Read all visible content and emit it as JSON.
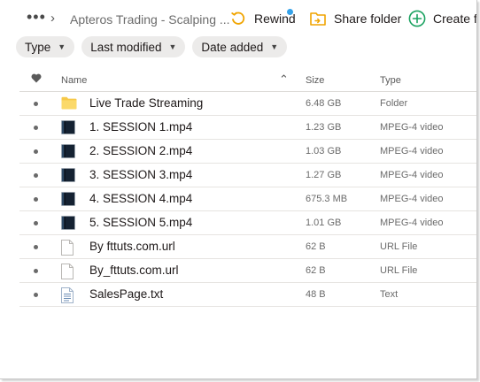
{
  "header": {
    "breadcrumb": "Apteros Trading - Scalping ...",
    "rewind_label": "Rewind",
    "share_label": "Share folder",
    "create_label": "Create fol"
  },
  "filters": [
    "Type",
    "Last modified",
    "Date added"
  ],
  "columns": {
    "name": "Name",
    "size": "Size",
    "type": "Type"
  },
  "files": [
    {
      "name": "Live Trade Streaming",
      "size": "6.48 GB",
      "type": "Folder",
      "icon": "folder-icon"
    },
    {
      "name": "1. SESSION 1.mp4",
      "size": "1.23 GB",
      "type": "MPEG-4 video",
      "icon": "video-icon"
    },
    {
      "name": "2. SESSION 2.mp4",
      "size": "1.03 GB",
      "type": "MPEG-4 video",
      "icon": "video-icon"
    },
    {
      "name": "3. SESSION 3.mp4",
      "size": "1.27 GB",
      "type": "MPEG-4 video",
      "icon": "video-icon"
    },
    {
      "name": "4. SESSION 4.mp4",
      "size": "675.3 MB",
      "type": "MPEG-4 video",
      "icon": "video-icon"
    },
    {
      "name": "5. SESSION 5.mp4",
      "size": "1.01 GB",
      "type": "MPEG-4 video",
      "icon": "video-icon"
    },
    {
      "name": "By fttuts.com.url",
      "size": "62 B",
      "type": "URL File",
      "icon": "url-file-icon"
    },
    {
      "name": "By_fttuts.com.url",
      "size": "62 B",
      "type": "URL File",
      "icon": "url-file-icon"
    },
    {
      "name": "SalesPage.txt",
      "size": "48 B",
      "type": "Text",
      "icon": "text-file-icon"
    }
  ],
  "colors": {
    "accent_green": "#1aa260",
    "folder_yellow": "#f7c948",
    "notification_blue": "#36a3ea"
  }
}
